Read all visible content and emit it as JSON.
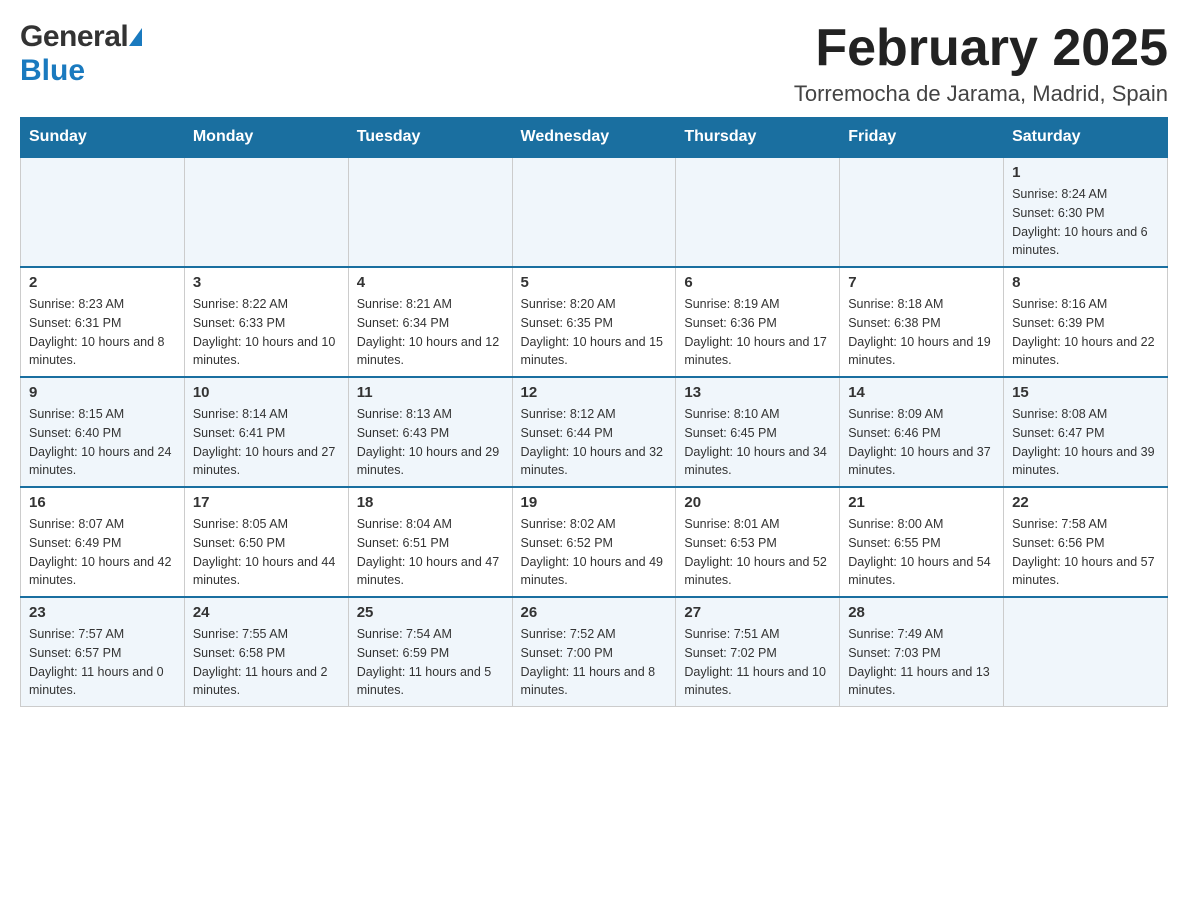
{
  "header": {
    "logo_general": "General",
    "logo_blue": "Blue",
    "title": "February 2025",
    "location": "Torremocha de Jarama, Madrid, Spain"
  },
  "days_of_week": [
    "Sunday",
    "Monday",
    "Tuesday",
    "Wednesday",
    "Thursday",
    "Friday",
    "Saturday"
  ],
  "weeks": [
    {
      "days": [
        {
          "num": "",
          "info": ""
        },
        {
          "num": "",
          "info": ""
        },
        {
          "num": "",
          "info": ""
        },
        {
          "num": "",
          "info": ""
        },
        {
          "num": "",
          "info": ""
        },
        {
          "num": "",
          "info": ""
        },
        {
          "num": "1",
          "info": "Sunrise: 8:24 AM\nSunset: 6:30 PM\nDaylight: 10 hours and 6 minutes."
        }
      ]
    },
    {
      "days": [
        {
          "num": "2",
          "info": "Sunrise: 8:23 AM\nSunset: 6:31 PM\nDaylight: 10 hours and 8 minutes."
        },
        {
          "num": "3",
          "info": "Sunrise: 8:22 AM\nSunset: 6:33 PM\nDaylight: 10 hours and 10 minutes."
        },
        {
          "num": "4",
          "info": "Sunrise: 8:21 AM\nSunset: 6:34 PM\nDaylight: 10 hours and 12 minutes."
        },
        {
          "num": "5",
          "info": "Sunrise: 8:20 AM\nSunset: 6:35 PM\nDaylight: 10 hours and 15 minutes."
        },
        {
          "num": "6",
          "info": "Sunrise: 8:19 AM\nSunset: 6:36 PM\nDaylight: 10 hours and 17 minutes."
        },
        {
          "num": "7",
          "info": "Sunrise: 8:18 AM\nSunset: 6:38 PM\nDaylight: 10 hours and 19 minutes."
        },
        {
          "num": "8",
          "info": "Sunrise: 8:16 AM\nSunset: 6:39 PM\nDaylight: 10 hours and 22 minutes."
        }
      ]
    },
    {
      "days": [
        {
          "num": "9",
          "info": "Sunrise: 8:15 AM\nSunset: 6:40 PM\nDaylight: 10 hours and 24 minutes."
        },
        {
          "num": "10",
          "info": "Sunrise: 8:14 AM\nSunset: 6:41 PM\nDaylight: 10 hours and 27 minutes."
        },
        {
          "num": "11",
          "info": "Sunrise: 8:13 AM\nSunset: 6:43 PM\nDaylight: 10 hours and 29 minutes."
        },
        {
          "num": "12",
          "info": "Sunrise: 8:12 AM\nSunset: 6:44 PM\nDaylight: 10 hours and 32 minutes."
        },
        {
          "num": "13",
          "info": "Sunrise: 8:10 AM\nSunset: 6:45 PM\nDaylight: 10 hours and 34 minutes."
        },
        {
          "num": "14",
          "info": "Sunrise: 8:09 AM\nSunset: 6:46 PM\nDaylight: 10 hours and 37 minutes."
        },
        {
          "num": "15",
          "info": "Sunrise: 8:08 AM\nSunset: 6:47 PM\nDaylight: 10 hours and 39 minutes."
        }
      ]
    },
    {
      "days": [
        {
          "num": "16",
          "info": "Sunrise: 8:07 AM\nSunset: 6:49 PM\nDaylight: 10 hours and 42 minutes."
        },
        {
          "num": "17",
          "info": "Sunrise: 8:05 AM\nSunset: 6:50 PM\nDaylight: 10 hours and 44 minutes."
        },
        {
          "num": "18",
          "info": "Sunrise: 8:04 AM\nSunset: 6:51 PM\nDaylight: 10 hours and 47 minutes."
        },
        {
          "num": "19",
          "info": "Sunrise: 8:02 AM\nSunset: 6:52 PM\nDaylight: 10 hours and 49 minutes."
        },
        {
          "num": "20",
          "info": "Sunrise: 8:01 AM\nSunset: 6:53 PM\nDaylight: 10 hours and 52 minutes."
        },
        {
          "num": "21",
          "info": "Sunrise: 8:00 AM\nSunset: 6:55 PM\nDaylight: 10 hours and 54 minutes."
        },
        {
          "num": "22",
          "info": "Sunrise: 7:58 AM\nSunset: 6:56 PM\nDaylight: 10 hours and 57 minutes."
        }
      ]
    },
    {
      "days": [
        {
          "num": "23",
          "info": "Sunrise: 7:57 AM\nSunset: 6:57 PM\nDaylight: 11 hours and 0 minutes."
        },
        {
          "num": "24",
          "info": "Sunrise: 7:55 AM\nSunset: 6:58 PM\nDaylight: 11 hours and 2 minutes."
        },
        {
          "num": "25",
          "info": "Sunrise: 7:54 AM\nSunset: 6:59 PM\nDaylight: 11 hours and 5 minutes."
        },
        {
          "num": "26",
          "info": "Sunrise: 7:52 AM\nSunset: 7:00 PM\nDaylight: 11 hours and 8 minutes."
        },
        {
          "num": "27",
          "info": "Sunrise: 7:51 AM\nSunset: 7:02 PM\nDaylight: 11 hours and 10 minutes."
        },
        {
          "num": "28",
          "info": "Sunrise: 7:49 AM\nSunset: 7:03 PM\nDaylight: 11 hours and 13 minutes."
        },
        {
          "num": "",
          "info": ""
        }
      ]
    }
  ]
}
